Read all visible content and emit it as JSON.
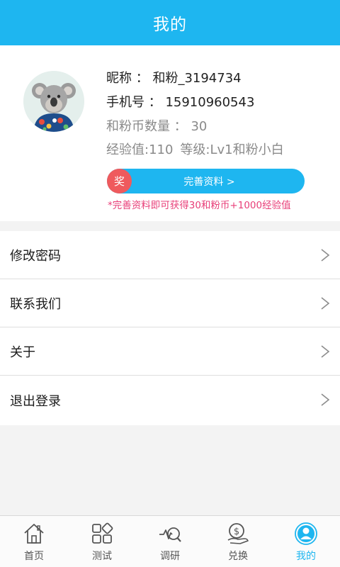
{
  "header": {
    "title": "我的"
  },
  "profile": {
    "nickname": "昵称 ： 和粉_3194734",
    "phone": "手机号 ： 15910960543",
    "coins": "和粉币数量 ： 30",
    "experience": "经验值:110",
    "level": "等级:Lv1和粉小白",
    "badge": "奖",
    "complete_button": "完善资料 >",
    "hint": "*完善资料即可获得30和粉币+1000经验值"
  },
  "menu": {
    "items": [
      {
        "label": "修改密码",
        "icon": "chevron-right-icon"
      },
      {
        "label": "联系我们",
        "icon": "chevron-right-icon"
      },
      {
        "label": "关于",
        "icon": "chevron-right-icon"
      },
      {
        "label": "退出登录",
        "icon": "chevron-right-icon"
      }
    ]
  },
  "tabbar": {
    "tabs": [
      {
        "label": "首页",
        "icon": "home-icon",
        "active": false
      },
      {
        "label": "测试",
        "icon": "grid-icon",
        "active": false
      },
      {
        "label": "调研",
        "icon": "chart-search-icon",
        "active": false
      },
      {
        "label": "兑换",
        "icon": "coin-exchange-icon",
        "active": false
      },
      {
        "label": "我的",
        "icon": "user-icon",
        "active": true
      }
    ]
  },
  "colors": {
    "accent": "#1eb6f0",
    "badge": "#ef5a5d",
    "hint": "#e83e78"
  }
}
